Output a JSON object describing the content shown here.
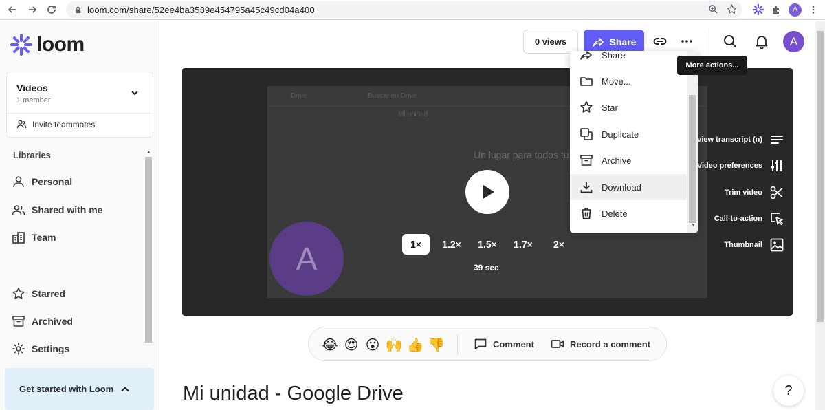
{
  "browser": {
    "url": "loom.com/share/52ee4ba3539e454795a45c49cd04a400",
    "profile_initial": "A"
  },
  "sidebar": {
    "brand": "loom",
    "workspace": {
      "title": "Videos",
      "subtitle": "1 member"
    },
    "invite_label": "Invite teammates",
    "libraries_label": "Libraries",
    "items": [
      {
        "label": "Personal",
        "icon": "person-icon"
      },
      {
        "label": "Shared with me",
        "icon": "people-icon"
      },
      {
        "label": "Team",
        "icon": "building-icon"
      },
      {
        "label": "Starred",
        "icon": "star-icon"
      },
      {
        "label": "Archived",
        "icon": "archive-icon"
      },
      {
        "label": "Settings",
        "icon": "gear-icon"
      }
    ],
    "get_started": "Get started with Loom"
  },
  "header": {
    "views": "0 views",
    "share": "Share",
    "avatar_initial": "A",
    "tooltip": "More actions..."
  },
  "video": {
    "speeds": [
      "1×",
      "1.2×",
      "1.5×",
      "1.7×",
      "2×"
    ],
    "active_speed": "1×",
    "duration": "39 sec",
    "frame_text": {
      "app": "Drive",
      "search": "Buscar en Drive",
      "folder": "Mi unidad",
      "headline": "Un lugar para todos tus",
      "avatar": "A"
    },
    "actions": [
      {
        "label": "view transcript (n)",
        "icon": "transcript-icon"
      },
      {
        "label": "Video preferences",
        "icon": "sliders-icon"
      },
      {
        "label": "Trim video",
        "icon": "scissors-icon"
      },
      {
        "label": "Call-to-action",
        "icon": "cursor-icon"
      },
      {
        "label": "Thumbnail",
        "icon": "image-icon"
      }
    ]
  },
  "menu": {
    "items": [
      {
        "label": "Share",
        "icon": "share-icon"
      },
      {
        "label": "Move...",
        "icon": "folder-icon"
      },
      {
        "label": "Star",
        "icon": "star-icon"
      },
      {
        "label": "Duplicate",
        "icon": "duplicate-icon"
      },
      {
        "label": "Archive",
        "icon": "archive-icon"
      },
      {
        "label": "Download",
        "icon": "download-icon"
      },
      {
        "label": "Delete",
        "icon": "trash-icon"
      }
    ],
    "hovered": "Download"
  },
  "reactions": {
    "emojis": [
      "😂",
      "😍",
      "😮",
      "🙌",
      "👍",
      "👎"
    ],
    "comment": "Comment",
    "record": "Record a comment"
  },
  "page_title": "Mi unidad - Google Drive",
  "help": "?",
  "colors": {
    "accent": "#625df5",
    "avatar": "#7a4fcf",
    "get_started_bg": "#dff0fb"
  }
}
